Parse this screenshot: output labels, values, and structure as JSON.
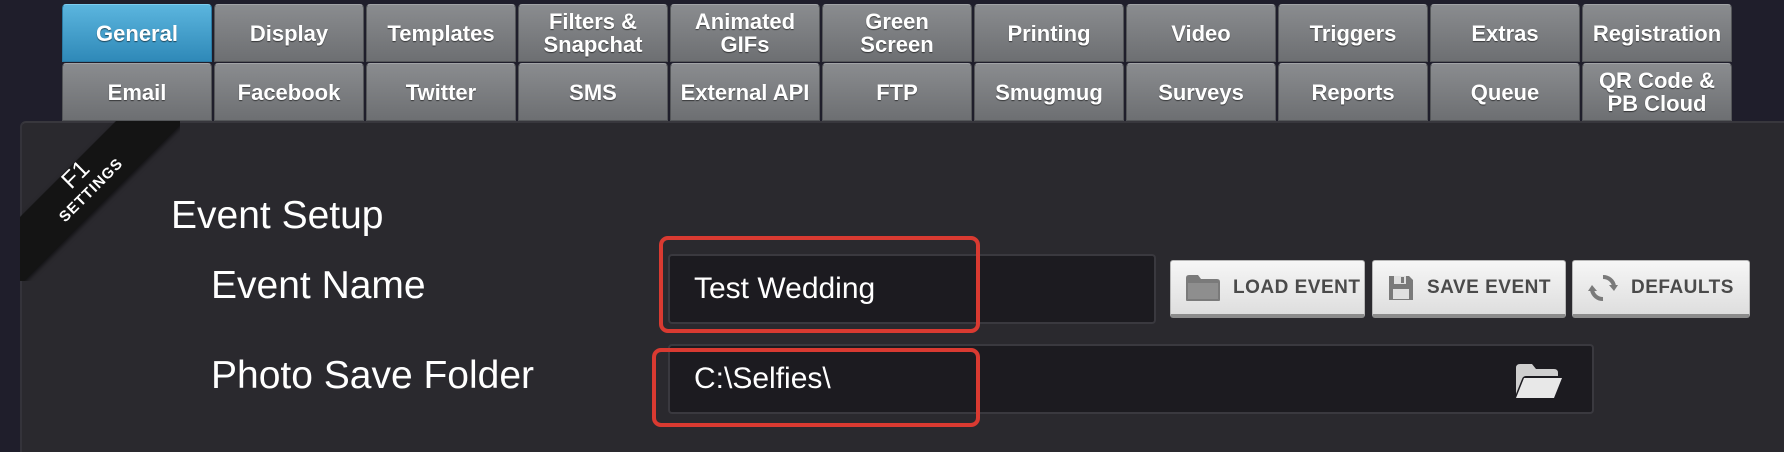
{
  "tabs": {
    "row1": [
      {
        "label": "General",
        "active": true
      },
      {
        "label": "Display"
      },
      {
        "label": "Templates"
      },
      {
        "label": "Filters & Snapchat"
      },
      {
        "label": "Animated GIFs"
      },
      {
        "label": "Green Screen"
      },
      {
        "label": "Printing"
      },
      {
        "label": "Video"
      },
      {
        "label": "Triggers"
      },
      {
        "label": "Extras"
      },
      {
        "label": "Registration"
      }
    ],
    "row2": [
      {
        "label": "Email"
      },
      {
        "label": "Facebook"
      },
      {
        "label": "Twitter"
      },
      {
        "label": "SMS"
      },
      {
        "label": "External API"
      },
      {
        "label": "FTP"
      },
      {
        "label": "Smugmug"
      },
      {
        "label": "Surveys"
      },
      {
        "label": "Reports"
      },
      {
        "label": "Queue"
      },
      {
        "label": "QR Code & PB Cloud"
      }
    ]
  },
  "ribbon": {
    "key": "F1",
    "label": "SETTINGS"
  },
  "event_setup": {
    "title": "Event Setup",
    "event_name": {
      "label": "Event Name",
      "value": "Test Wedding"
    },
    "photo_save_folder": {
      "label": "Photo Save Folder",
      "value": "C:\\Selfies\\",
      "browse_icon": "folder-open-icon"
    },
    "buttons": {
      "load_event": "LOAD EVENT",
      "save_event": "SAVE EVENT",
      "defaults": "DEFAULTS"
    }
  },
  "colors": {
    "active_tab": "#3a9fd0",
    "tab": "#7a7c7f",
    "highlight": "#d93a31",
    "background": "#1f1e2b",
    "panel": "#2a292e"
  }
}
